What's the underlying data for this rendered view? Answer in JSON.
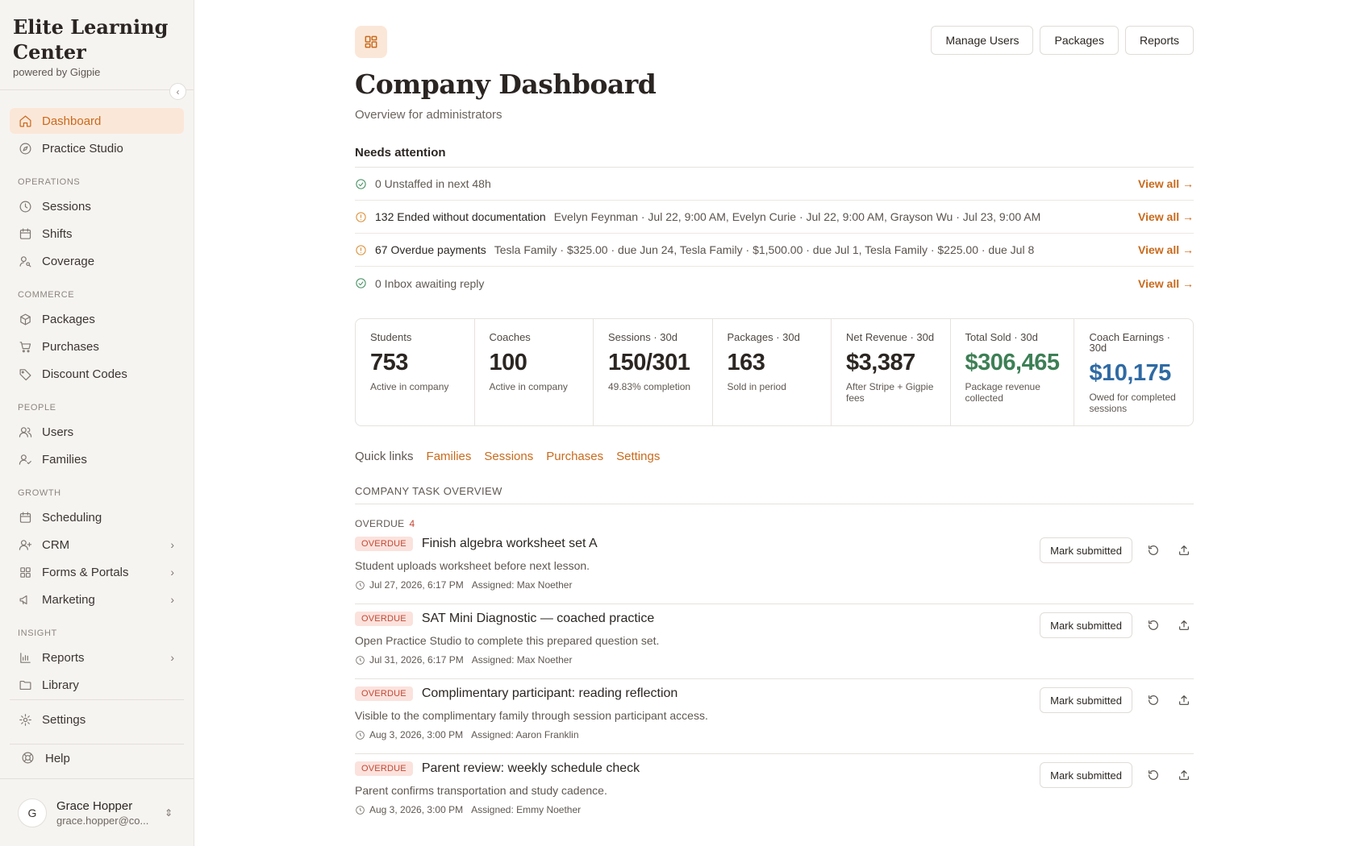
{
  "brand": {
    "title_line1": "Elite Learning",
    "title_line2": "Center",
    "subtitle": "powered by Gigpie"
  },
  "nav": {
    "dashboard": "Dashboard",
    "practice": "Practice Studio",
    "sec_operations": "OPERATIONS",
    "sessions": "Sessions",
    "shifts": "Shifts",
    "coverage": "Coverage",
    "sec_commerce": "COMMERCE",
    "packages": "Packages",
    "purchases": "Purchases",
    "discounts": "Discount Codes",
    "sec_people": "PEOPLE",
    "users": "Users",
    "families": "Families",
    "sec_growth": "GROWTH",
    "scheduling": "Scheduling",
    "crm": "CRM",
    "forms": "Forms & Portals",
    "marketing": "Marketing",
    "sec_insight": "INSIGHT",
    "reports": "Reports",
    "library": "Library",
    "settings": "Settings",
    "help": "Help"
  },
  "user": {
    "initial": "G",
    "name": "Grace Hopper",
    "email": "grace.hopper@co..."
  },
  "header": {
    "title": "Company Dashboard",
    "subtitle": "Overview for administrators",
    "buttons": {
      "manage_users": "Manage Users",
      "packages": "Packages",
      "reports": "Reports"
    }
  },
  "attention": {
    "title": "Needs attention",
    "view_all": "View all →",
    "rows": [
      {
        "label": "0 Unstaffed in next 48h",
        "detail": ""
      },
      {
        "label": "132 Ended without documentation",
        "detail": "Evelyn Feynman · Jul 22, 9:00 AM, Evelyn Curie · Jul 22, 9:00 AM, Grayson Wu · Jul 23, 9:00 AM"
      },
      {
        "label": "67 Overdue payments",
        "detail": "Tesla Family · $325.00 · due Jun 24, Tesla Family · $1,500.00 · due Jul 1, Tesla Family · $225.00 · due Jul 8"
      },
      {
        "label": "0 Inbox awaiting reply",
        "detail": ""
      }
    ]
  },
  "stats": [
    {
      "label": "Students",
      "value": "753",
      "note": "Active in company"
    },
    {
      "label": "Coaches",
      "value": "100",
      "note": "Active in company"
    },
    {
      "label": "Sessions · 30d",
      "value": "150/301",
      "note": "49.83% completion"
    },
    {
      "label": "Packages · 30d",
      "value": "163",
      "note": "Sold in period"
    },
    {
      "label": "Net Revenue · 30d",
      "value": "$3,387",
      "note": "After Stripe + Gigpie fees"
    },
    {
      "label": "Total Sold · 30d",
      "value": "$306,465",
      "note": "Package revenue collected"
    },
    {
      "label": "Coach Earnings · 30d",
      "value": "$10,175",
      "note": "Owed for completed sessions"
    }
  ],
  "quick_links": {
    "label": "Quick links",
    "links": [
      "Families",
      "Sessions",
      "Purchases",
      "Settings"
    ]
  },
  "tasks": {
    "heading": "COMPANY TASK OVERVIEW",
    "group_label": "OVERDUE",
    "group_count": "4",
    "badge": "OVERDUE",
    "action_label": "Mark submitted",
    "items": [
      {
        "title": "Finish algebra worksheet set A",
        "desc": "Student uploads worksheet before next lesson.",
        "date": "Jul 27, 2026, 6:17 PM",
        "assigned": "Assigned: Max Noether"
      },
      {
        "title": "SAT Mini Diagnostic — coached practice",
        "desc": "Open Practice Studio to complete this prepared question set.",
        "date": "Jul 31, 2026, 6:17 PM",
        "assigned": "Assigned: Max Noether"
      },
      {
        "title": "Complimentary participant: reading reflection",
        "desc": "Visible to the complimentary family through session participant access.",
        "date": "Aug 3, 2026, 3:00 PM",
        "assigned": "Assigned: Aaron Franklin"
      },
      {
        "title": "Parent review: weekly schedule check",
        "desc": "Parent confirms transportation and study cadence.",
        "date": "Aug 3, 2026, 3:00 PM",
        "assigned": "Assigned: Emmy Noether"
      }
    ]
  }
}
